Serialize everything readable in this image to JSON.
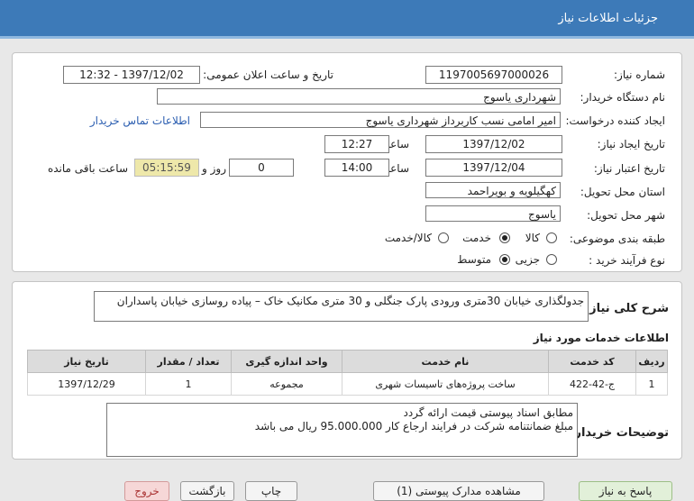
{
  "header": {
    "title": "جزئیات اطلاعات نیاز"
  },
  "details": {
    "need_number_label": "شماره نیاز:",
    "need_number": "1197005697000026",
    "announce_label": "تاریخ و ساعت اعلان عمومی:",
    "announce_value": "1397/12/02 - 12:32",
    "buyer_label": "نام دستگاه خریدار:",
    "buyer_value": "شهرداری یاسوج",
    "requester_label": "ایجاد کننده درخواست:",
    "requester_value": "امیر امامی نسب کاربرداز شهرداری یاسوج",
    "contact_link": "اطلاعات تماس خریدار",
    "created_label": "تاریخ ایجاد نیاز:",
    "created_date": "1397/12/02",
    "time_label": "ساعت",
    "created_time": "12:27",
    "validity_label": "تاریخ اعتبار نیاز:",
    "validity_date": "1397/12/04",
    "validity_time": "14:00",
    "days_value": "0",
    "days_label": "روز و",
    "remaining_time": "05:15:59",
    "remaining_label": "ساعت باقی مانده",
    "province_label": "استان محل تحویل:",
    "province_value": "کهگیلویه و بویراحمد",
    "city_label": "شهر محل تحویل:",
    "city_value": "یاسوج",
    "category_label": "طبقه بندی موضوعی:",
    "category_options": [
      "کالا",
      "خدمت",
      "کالا/خدمت"
    ],
    "category_selected": 1,
    "process_label": "نوع فرآیند خرید :",
    "process_options": [
      "جزیی",
      "متوسط"
    ],
    "process_selected": 1
  },
  "description": {
    "label": "شرح کلی نیاز:",
    "text": "جدولگذاری خیابان 30متری ورودی پارک جنگلی و 30 متری مکانیک خاک – پیاده روسازی خیابان پاسداران"
  },
  "services": {
    "title": "اطلاعات خدمات مورد نیاز",
    "columns": [
      "ردیف",
      "کد خدمت",
      "نام خدمت",
      "واحد اندازه گیری",
      "تعداد / مقدار",
      "تاریخ نیاز"
    ],
    "rows": [
      [
        "1",
        "ج-42-422",
        "ساخت پروژه‌های تاسیسات شهری",
        "مجموعه",
        "1",
        "1397/12/29"
      ]
    ]
  },
  "buyer_notes": {
    "label": "توضیحات خریدار:",
    "lines": [
      "مطابق اسناد پیوستی قیمت ارائه گردد",
      "مبلغ ضمانتنامه شرکت در فرایند ارجاع کار 95.000.000 ریال می باشد"
    ]
  },
  "buttons": {
    "reply": "پاسخ به نیاز",
    "attachments": "مشاهده مدارک پیوستی (1)",
    "print": "چاپ",
    "back": "بازگشت",
    "exit": "خروج"
  },
  "colors": {
    "header_bg": "#3d7ab8",
    "link": "#2a5db0"
  }
}
